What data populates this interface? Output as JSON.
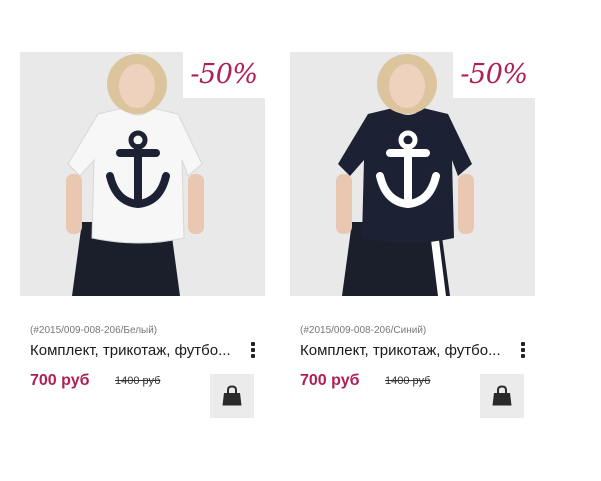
{
  "products": [
    {
      "discount": "-50%",
      "sku": "(#2015/009-008-206/Белый)",
      "title": "Комплект, трикотаж, футбо...",
      "price": "700 руб",
      "old_price": "1400 руб",
      "shirt_color": "#f7f7f7",
      "anchor_color": "#1c2233",
      "cart_icon": "shopping-bag-icon",
      "more_icon": "more-vertical-icon"
    },
    {
      "discount": "-50%",
      "sku": "(#2015/009-008-206/Синий)",
      "title": "Комплект, трикотаж, футбо...",
      "price": "700 руб",
      "old_price": "1400 руб",
      "shirt_color": "#1c2233",
      "anchor_color": "#ffffff",
      "cart_icon": "shopping-bag-icon",
      "more_icon": "more-vertical-icon"
    }
  ],
  "colors": {
    "accent": "#b01e55",
    "photo_background": "#e9e9ea",
    "cart_button_background": "#ebebeb",
    "pants": "#1b1f2b"
  }
}
